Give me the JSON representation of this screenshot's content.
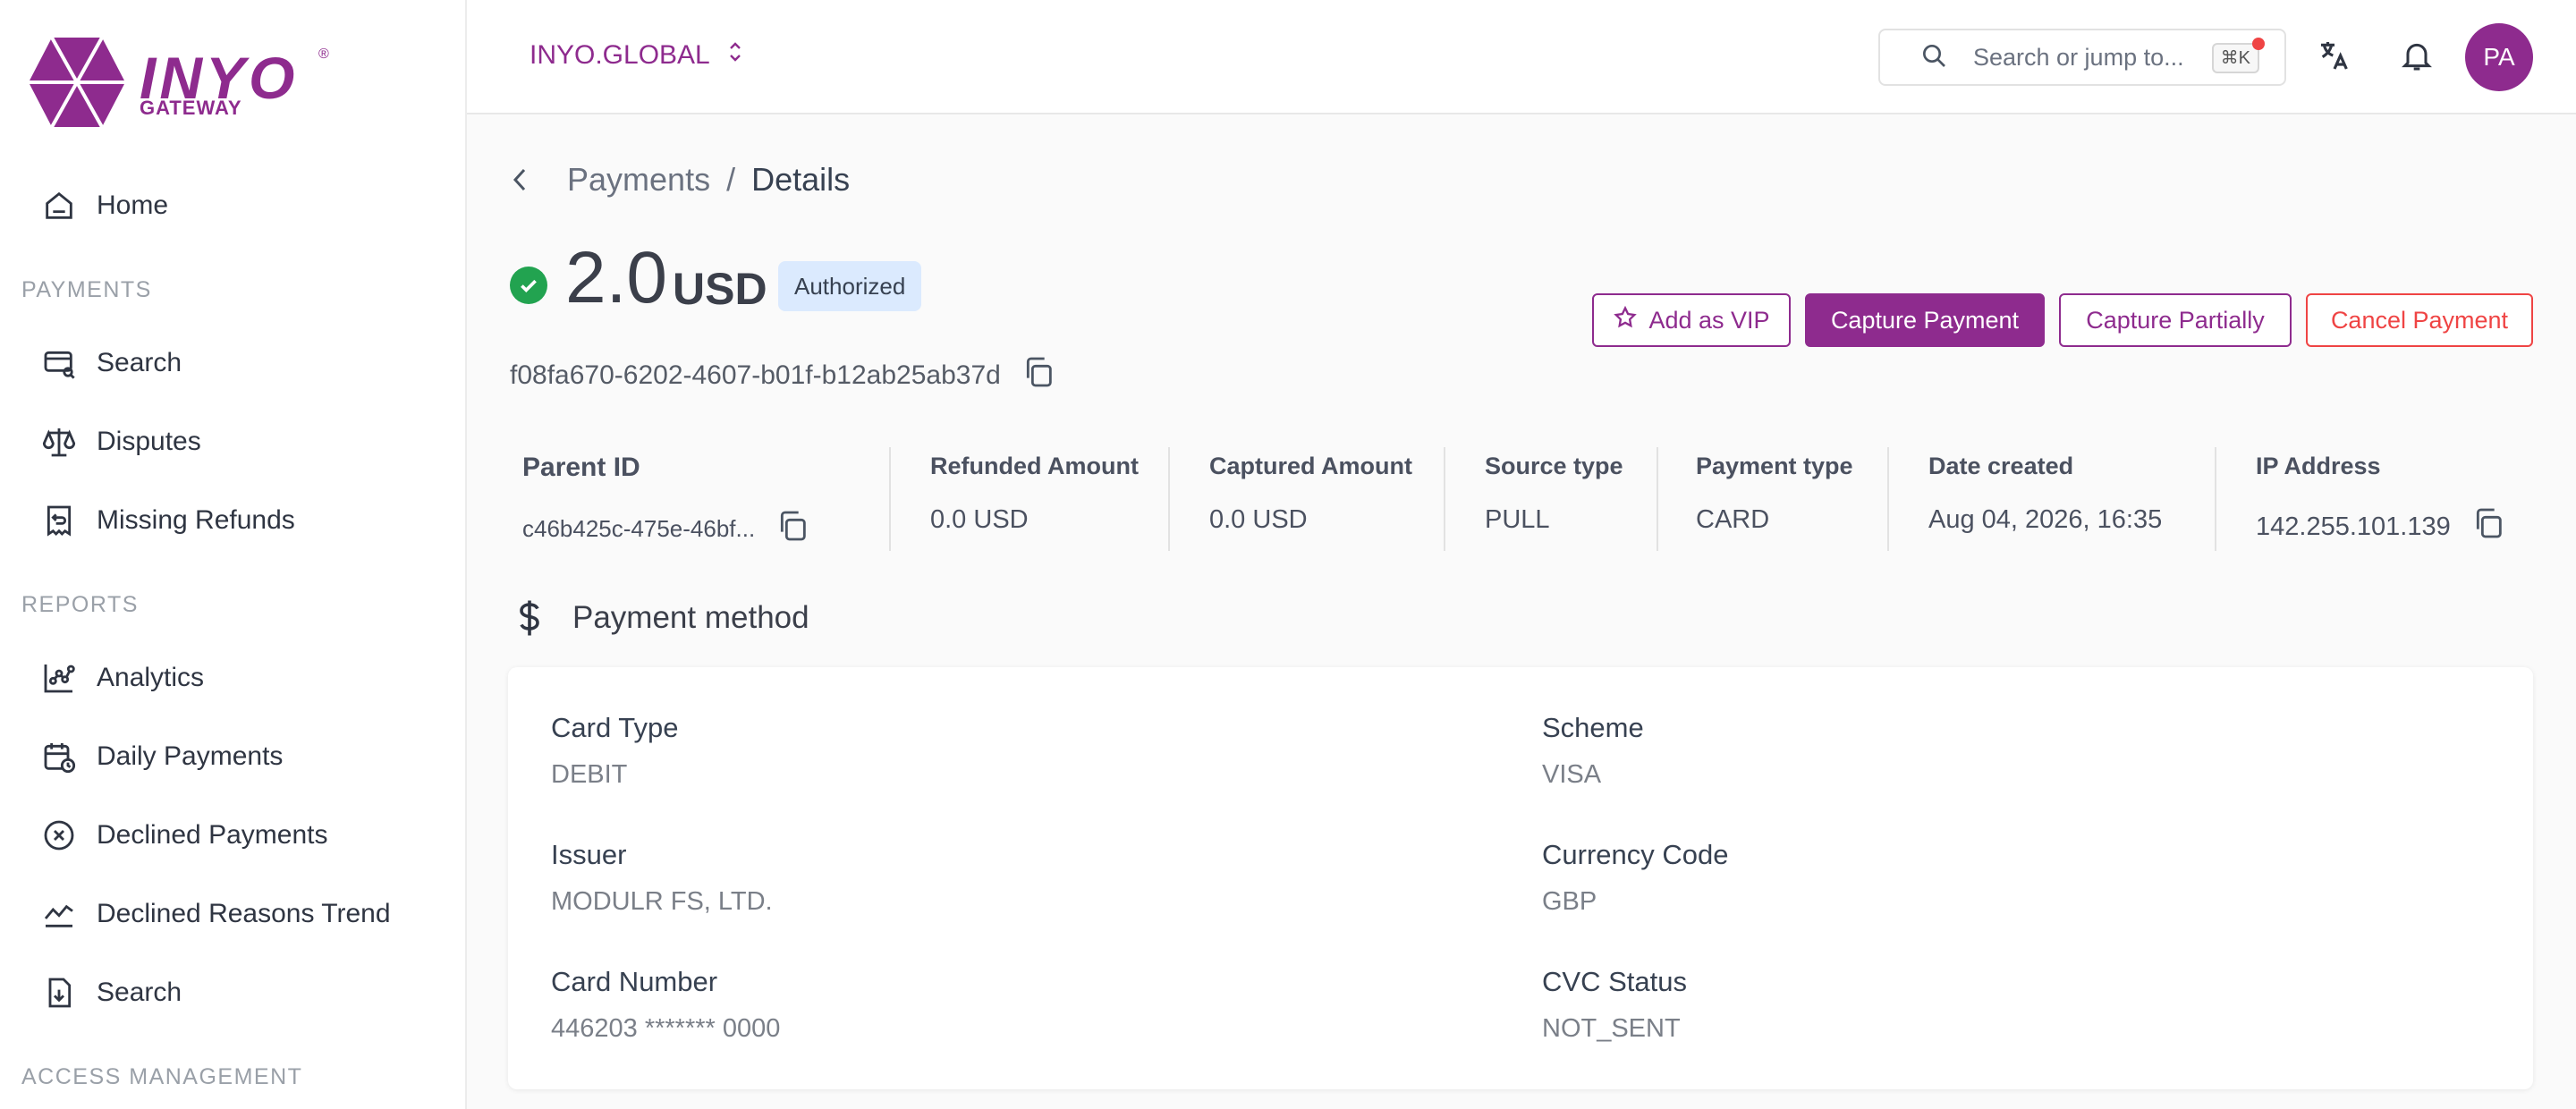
{
  "brand": {
    "name": "INYO",
    "sub": "GATEWAY",
    "reg": "®"
  },
  "sidebar": {
    "home": "Home",
    "payments_section": "PAYMENTS",
    "payments_items": [
      "Search",
      "Disputes",
      "Missing Refunds"
    ],
    "reports_section": "REPORTS",
    "reports_items": [
      "Analytics",
      "Daily Payments",
      "Declined Payments",
      "Declined Reasons Trend",
      "Search"
    ],
    "access_section": "ACCESS MANAGEMENT"
  },
  "topbar": {
    "org": "INYO.GLOBAL",
    "search_placeholder": "Search or jump to...",
    "shortcut": "⌘K",
    "avatar": "PA"
  },
  "breadcrumb": {
    "parent": "Payments",
    "separator": "/",
    "current": "Details"
  },
  "payment": {
    "amount": "2.0",
    "currency": "USD",
    "status": "Authorized",
    "id": "f08fa670-6202-4607-b01f-b12ab25ab37d"
  },
  "actions": {
    "vip": "Add as VIP",
    "capture": "Capture Payment",
    "partial": "Capture Partially",
    "cancel": "Cancel Payment"
  },
  "meta": {
    "parent_id_label": "Parent ID",
    "parent_id": "c46b425c-475e-46bf...",
    "refunded_label": "Refunded Amount",
    "refunded": "0.0 USD",
    "captured_label": "Captured Amount",
    "captured": "0.0 USD",
    "source_label": "Source type",
    "source": "PULL",
    "ptype_label": "Payment type",
    "ptype": "CARD",
    "date_label": "Date created",
    "date": "Aug 04, 2026, 16:35",
    "ip_label": "IP Address",
    "ip": "142.255.101.139"
  },
  "payment_method": {
    "title": "Payment method",
    "card_type_label": "Card Type",
    "card_type": "DEBIT",
    "scheme_label": "Scheme",
    "scheme": "VISA",
    "issuer_label": "Issuer",
    "issuer": "MODULR FS, LTD.",
    "currency_code_label": "Currency Code",
    "currency_code": "GBP",
    "card_number_label": "Card Number",
    "card_number": "446203 ******* 0000",
    "cvc_label": "CVC Status",
    "cvc": "NOT_SENT"
  },
  "colors": {
    "brand": "#8e2b8e",
    "success": "#22a350",
    "danger": "#ef4444",
    "badge": "#dbeafe"
  }
}
